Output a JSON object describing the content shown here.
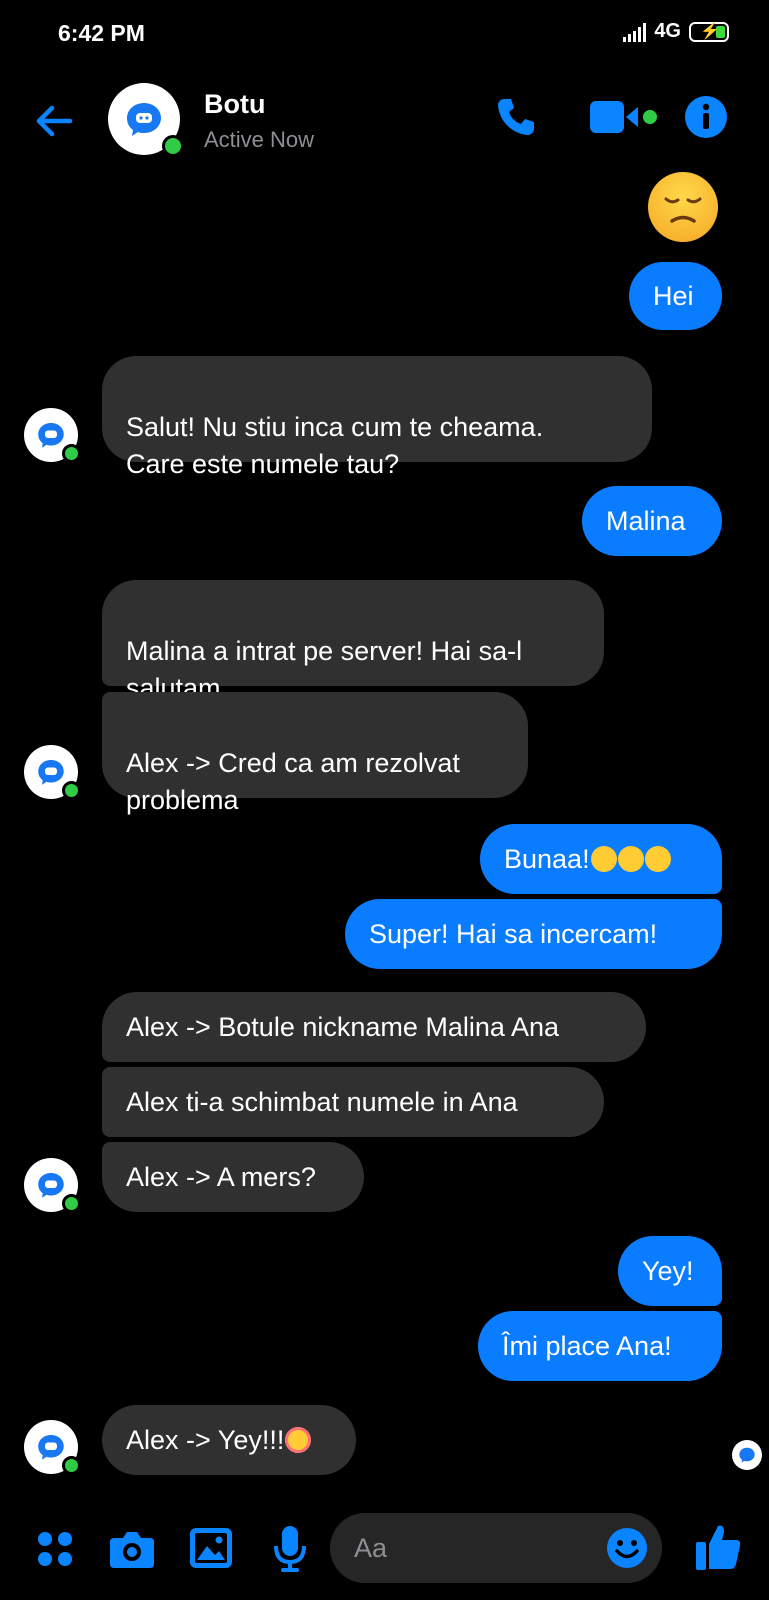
{
  "status_bar": {
    "time": "6:42 PM",
    "network": "4G"
  },
  "header": {
    "name": "Botu",
    "status": "Active Now",
    "accent": "#0a84ff",
    "online_color": "#31cc46"
  },
  "messages": [
    {
      "from": "me",
      "text": "Hei"
    },
    {
      "from": "bot",
      "text": "Salut! Nu stiu inca cum te cheama.\nCare este numele tau?"
    },
    {
      "from": "me",
      "text": "Malina"
    },
    {
      "from": "bot",
      "text": "Malina a intrat pe server! Hai sa-l\nsalutam"
    },
    {
      "from": "bot",
      "text": "Alex -> Cred ca am rezolvat\nproblema"
    },
    {
      "from": "me",
      "text": "Bunaa!"
    },
    {
      "from": "me",
      "text": "Super! Hai sa incercam!"
    },
    {
      "from": "bot",
      "text": "Alex -> Botule nickname Malina Ana"
    },
    {
      "from": "bot",
      "text": "Alex ti-a schimbat numele in Ana"
    },
    {
      "from": "bot",
      "text": "Alex -> A mers?"
    },
    {
      "from": "me",
      "text": "Yey!"
    },
    {
      "from": "me",
      "text": "Îmi place Ana!"
    },
    {
      "from": "bot",
      "text": "Alex -> Yey!!!"
    }
  ],
  "composer": {
    "placeholder": "Aa",
    "icons": [
      "menu-dots-icon",
      "camera-icon",
      "gallery-icon",
      "microphone-icon",
      "emoji-icon",
      "like-icon"
    ]
  }
}
